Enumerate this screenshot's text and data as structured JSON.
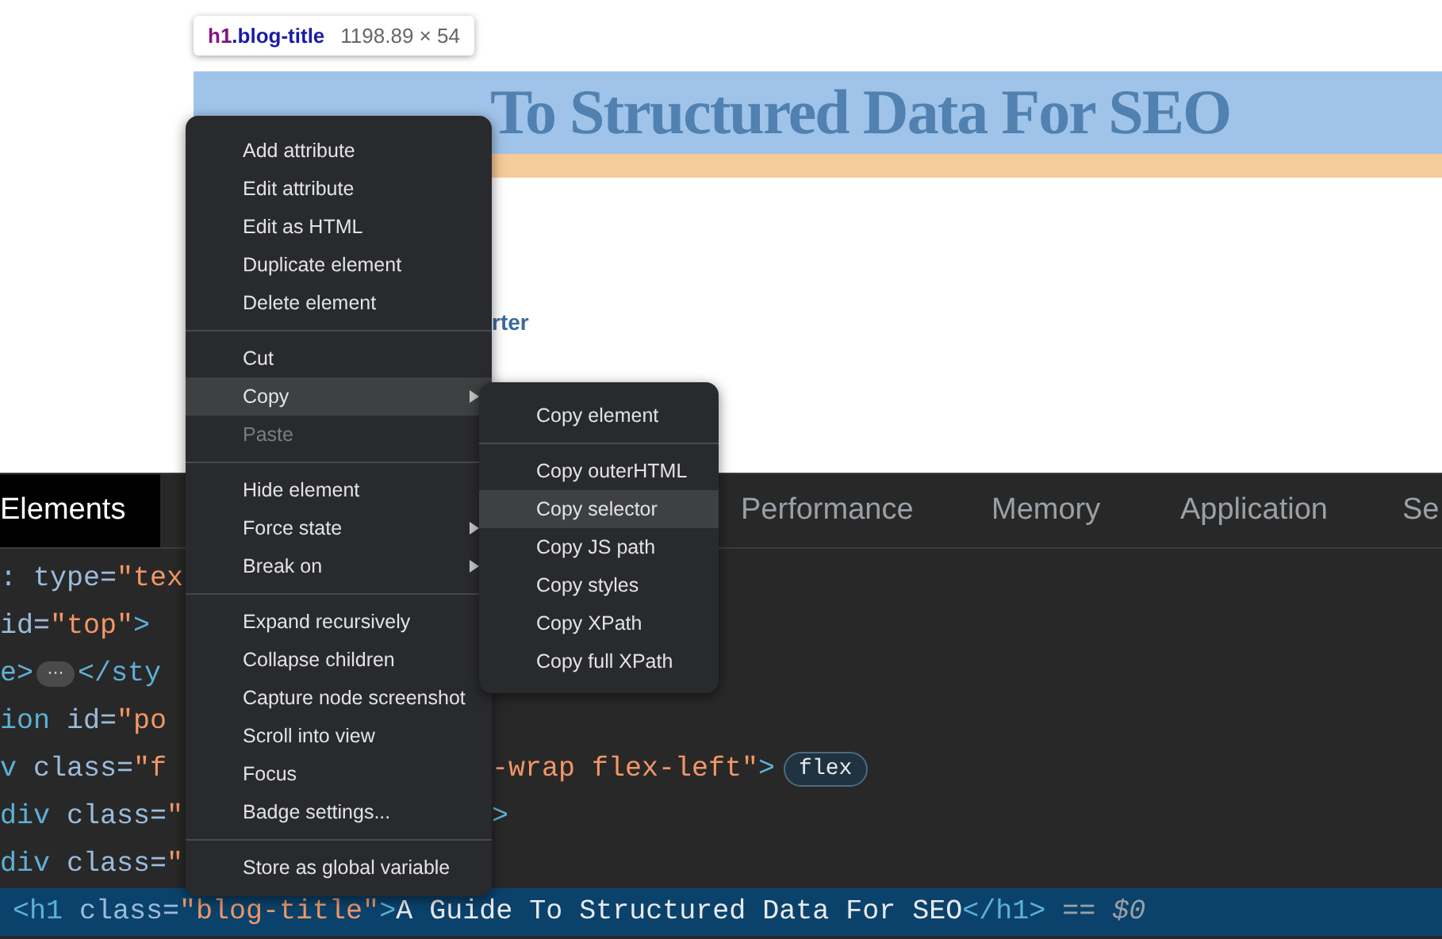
{
  "tooltip": {
    "tag": "h1",
    "class_name": ".blog-title",
    "size": "1198.89 × 54"
  },
  "page": {
    "title": "To Structured Data For SEO",
    "link_fragment": "rter"
  },
  "devtools": {
    "tabs": [
      {
        "label": "Elements",
        "selected": true
      },
      {
        "label": "Performance",
        "selected": false
      },
      {
        "label": "Memory",
        "selected": false
      },
      {
        "label": "Application",
        "selected": false
      },
      {
        "label": "Se",
        "selected": false
      }
    ],
    "lines": [
      {
        "selected": false,
        "left": [
          {
            "kind": "attr",
            "text": ": type="
          },
          {
            "kind": "value",
            "text": "\"tex"
          }
        ]
      },
      {
        "selected": false,
        "left": [
          {
            "kind": "attr",
            "text": "id="
          },
          {
            "kind": "value",
            "text": "\"top\""
          },
          {
            "kind": "tag",
            "text": ">"
          }
        ]
      },
      {
        "selected": false,
        "left": [
          {
            "kind": "tag",
            "text": "e>"
          },
          {
            "kind": "ellipsis",
            "text": "···"
          },
          {
            "kind": "tag",
            "text": "</sty"
          }
        ]
      },
      {
        "selected": false,
        "left": [
          {
            "kind": "tag",
            "text": "ion"
          },
          {
            "kind": "attr",
            "text": " id="
          },
          {
            "kind": "value",
            "text": "\"po"
          }
        ]
      },
      {
        "selected": false,
        "left": [
          {
            "kind": "tag",
            "text": "v"
          },
          {
            "kind": "attr",
            "text": " class="
          },
          {
            "kind": "value",
            "text": "\"f"
          }
        ],
        "right": [
          {
            "kind": "value",
            "text": "-wrap flex-left\""
          },
          {
            "kind": "tag",
            "text": ">"
          },
          {
            "kind": "badge",
            "text": "flex"
          }
        ]
      },
      {
        "selected": false,
        "left": [
          {
            "kind": "tag",
            "text": "div"
          },
          {
            "kind": "attr",
            "text": " class="
          },
          {
            "kind": "value",
            "text": "\""
          }
        ],
        "right": [
          {
            "kind": "tag",
            "text": ">"
          }
        ]
      },
      {
        "selected": false,
        "left": [
          {
            "kind": "tag",
            "text": "div"
          },
          {
            "kind": "attr",
            "text": " class="
          },
          {
            "kind": "value",
            "text": "\""
          }
        ]
      },
      {
        "selected": true,
        "left": [
          {
            "kind": "tag",
            "text": "<h1"
          },
          {
            "kind": "attr",
            "text": " class="
          },
          {
            "kind": "value",
            "text": "\"blog-title\""
          },
          {
            "kind": "tag",
            "text": ">"
          },
          {
            "kind": "text",
            "text": "A Guide To Structured Data For SEO"
          },
          {
            "kind": "tag",
            "text": "</h1>"
          },
          {
            "kind": "ref",
            "text": " == $0"
          }
        ]
      }
    ]
  },
  "context_menu": [
    {
      "kind": "item",
      "label": "Add attribute",
      "selected": false,
      "disabled": false,
      "submenu": false
    },
    {
      "kind": "item",
      "label": "Edit attribute",
      "selected": false,
      "disabled": false,
      "submenu": false
    },
    {
      "kind": "item",
      "label": "Edit as HTML",
      "selected": false,
      "disabled": false,
      "submenu": false
    },
    {
      "kind": "item",
      "label": "Duplicate element",
      "selected": false,
      "disabled": false,
      "submenu": false
    },
    {
      "kind": "item",
      "label": "Delete element",
      "selected": false,
      "disabled": false,
      "submenu": false
    },
    {
      "kind": "separator"
    },
    {
      "kind": "item",
      "label": "Cut",
      "selected": false,
      "disabled": false,
      "submenu": false
    },
    {
      "kind": "item",
      "label": "Copy",
      "selected": true,
      "disabled": false,
      "submenu": true
    },
    {
      "kind": "item",
      "label": "Paste",
      "selected": false,
      "disabled": true,
      "submenu": false
    },
    {
      "kind": "separator"
    },
    {
      "kind": "item",
      "label": "Hide element",
      "selected": false,
      "disabled": false,
      "submenu": false
    },
    {
      "kind": "item",
      "label": "Force state",
      "selected": false,
      "disabled": false,
      "submenu": true
    },
    {
      "kind": "item",
      "label": "Break on",
      "selected": false,
      "disabled": false,
      "submenu": true
    },
    {
      "kind": "separator"
    },
    {
      "kind": "item",
      "label": "Expand recursively",
      "selected": false,
      "disabled": false,
      "submenu": false
    },
    {
      "kind": "item",
      "label": "Collapse children",
      "selected": false,
      "disabled": false,
      "submenu": false
    },
    {
      "kind": "item",
      "label": "Capture node screenshot",
      "selected": false,
      "disabled": false,
      "submenu": false
    },
    {
      "kind": "item",
      "label": "Scroll into view",
      "selected": false,
      "disabled": false,
      "submenu": false
    },
    {
      "kind": "item",
      "label": "Focus",
      "selected": false,
      "disabled": false,
      "submenu": false
    },
    {
      "kind": "item",
      "label": "Badge settings...",
      "selected": false,
      "disabled": false,
      "submenu": false
    },
    {
      "kind": "separator"
    },
    {
      "kind": "item",
      "label": "Store as global variable",
      "selected": false,
      "disabled": false,
      "submenu": false
    }
  ],
  "copy_submenu": [
    {
      "kind": "item",
      "label": "Copy element",
      "selected": false
    },
    {
      "kind": "separator"
    },
    {
      "kind": "item",
      "label": "Copy outerHTML",
      "selected": false
    },
    {
      "kind": "item",
      "label": "Copy selector",
      "selected": true
    },
    {
      "kind": "item",
      "label": "Copy JS path",
      "selected": false
    },
    {
      "kind": "item",
      "label": "Copy styles",
      "selected": false
    },
    {
      "kind": "item",
      "label": "Copy XPath",
      "selected": false
    },
    {
      "kind": "item",
      "label": "Copy full XPath",
      "selected": false
    }
  ]
}
